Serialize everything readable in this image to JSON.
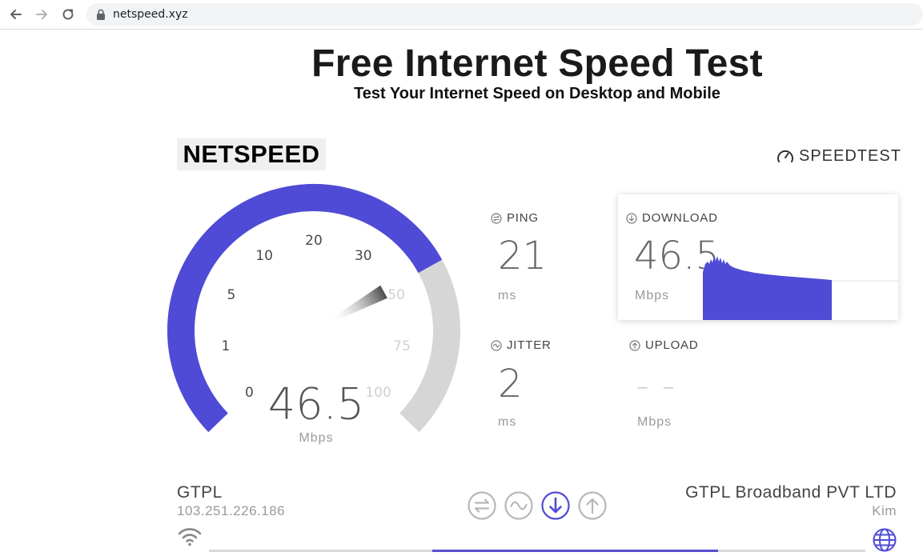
{
  "browser": {
    "url": "netspeed.xyz",
    "icons": [
      "back-arrow-icon",
      "forward-arrow-icon",
      "reload-icon",
      "lock-icon"
    ]
  },
  "header": {
    "title": "Free Internet Speed Test",
    "subtitle": "Test Your Internet Speed on Desktop and Mobile"
  },
  "brand": {
    "netspeed_logo": "NETSPEED",
    "speedtest_logo": "SPEEDTEST"
  },
  "gauge": {
    "value": "46.5",
    "unit": "Mbps",
    "value_numeric": 46.5,
    "ticks": [
      "0",
      "1",
      "5",
      "10",
      "20",
      "30",
      "50",
      "75",
      "100"
    ],
    "accent_color": "#4f4bd6",
    "track_color": "#d6d6d6"
  },
  "metrics": {
    "ping": {
      "label": "PING",
      "value": "21",
      "unit": "ms",
      "icon": "ping-icon"
    },
    "jitter": {
      "label": "JITTER",
      "value": "2",
      "unit": "ms",
      "icon": "jitter-icon"
    },
    "download": {
      "label": "DOWNLOAD",
      "value": "46.5",
      "unit": "Mbps",
      "icon": "download-icon"
    },
    "upload": {
      "label": "UPLOAD",
      "value": "– –",
      "unit": "Mbps",
      "icon": "upload-icon"
    }
  },
  "isp": {
    "name": "GTPL",
    "ip": "103.251.226.186"
  },
  "server": {
    "name": "GTPL Broadband PVT LTD",
    "location": "Kim"
  },
  "steps": {
    "icons": [
      "ping-step-icon",
      "jitter-step-icon",
      "download-step-icon",
      "upload-step-icon"
    ],
    "active_index": 2,
    "active_color": "#4f4bd6",
    "inactive_color": "#b8b8b8"
  },
  "progress": {
    "fraction": 0.66
  }
}
